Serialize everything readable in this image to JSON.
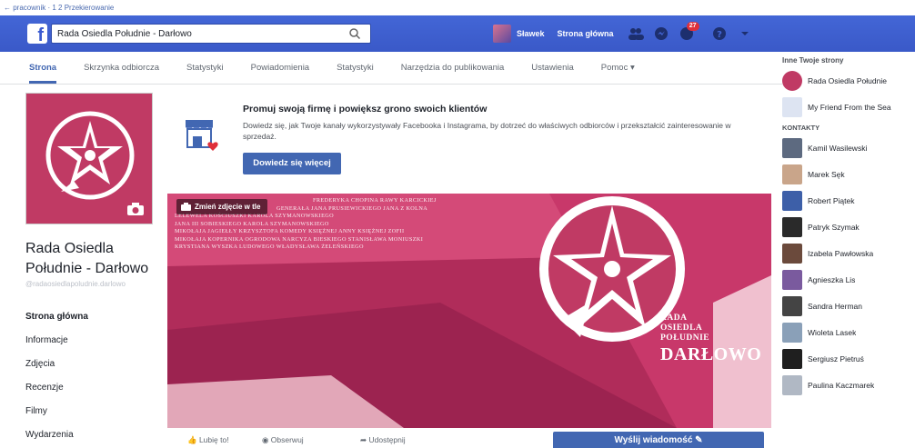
{
  "browser_strip": {
    "text": "← pracownik · 1 2 Przekierowanie"
  },
  "topbar": {
    "search_value": "Rada Osiedla Południe - Darłowo",
    "profile_name": "Sławek",
    "home_label": "Strona główna",
    "notifications_badge": "27",
    "colors": {
      "bar": "#3b5bd0",
      "badge": "#e0303a"
    },
    "icons": [
      "facebook-logo-icon",
      "search-icon",
      "friends-icon",
      "messages-icon",
      "notifications-icon",
      "help-icon",
      "dropdown-icon"
    ]
  },
  "page_tabs": [
    {
      "label": "Strona",
      "active": true
    },
    {
      "label": "Skrzynka odbiorcza",
      "active": false
    },
    {
      "label": "Statystyki",
      "active": false
    },
    {
      "label": "Powiadomienia",
      "active": false
    },
    {
      "label": "Statystyki",
      "active": false
    },
    {
      "label": "Narzędzia do publikowania",
      "active": false
    },
    {
      "label": "Ustawienia",
      "active": false
    },
    {
      "label": "Pomoc ▾",
      "active": false
    }
  ],
  "page": {
    "name": "Rada Osiedla Południe - Darłowo",
    "handle": "@radaosiedlapoludnie.darlowo"
  },
  "left_nav": [
    {
      "label": "Strona główna",
      "active": true
    },
    {
      "label": "Informacje",
      "active": false
    },
    {
      "label": "Zdjęcia",
      "active": false
    },
    {
      "label": "Recenzje",
      "active": false
    },
    {
      "label": "Filmy",
      "active": false
    },
    {
      "label": "Wydarzenia",
      "active": false
    }
  ],
  "promo": {
    "title": "Promuj swoją firmę i powiększ grono swoich klientów",
    "text": "Dowiedz się, jak Twoje kanały wykorzystywały Facebooka i Instagrama, by dotrzeć do właściwych odbiorców i przekształcić zainteresowanie w sprzedaż.",
    "button_label": "Dowiedz się więcej"
  },
  "cover": {
    "change_photo_label": "Zmień zdjęcie w tle",
    "street_lines": [
      "FREDERYKA   CHOPINA   RAWY   KARCICKIEJ",
      "GENERAŁA  JANA  PRUSIEWICKIEGO  JANA  Z  KOLNA",
      "LELEWELA   KOŚCIUSZKI   KAROLA   SZYMANOWSKIEGO",
      "JANA   III   SOBIESKIEGO   KAROLA   SZYMANOWSKIEGO",
      "MIKOŁAJA  JAGIEŁŁY  KRZYSZTOFA  KOMEDY  KSIĘŻNEJ  ANNY  KSIĘŻNEJ  ZOFII",
      "MIKOŁAJA  KOPERNIKA  OGRODOWA  NARCYZA  BIESKIEGO  STANISŁAWA  MONIUSZKI",
      "KRYSTIANA   WYSZKA   LUDOWEGO   WŁADYSŁAWA   ŻELEŃSKIEGO"
    ],
    "title_line1": "RADA",
    "title_line2": "OSIEDLA",
    "title_line3": "POŁUDNIE",
    "title_line4": "DARŁOWO",
    "colors": {
      "background": "#d44a78",
      "dark": "#9c2350"
    }
  },
  "actions": {
    "like": "Lubię to!",
    "follow": "Obserwuj",
    "share": "Udostępnij",
    "send_message": "Wyślij wiadomość"
  },
  "right_column": {
    "heading": "Inne Twoje strony",
    "pages": [
      {
        "name": "Rada Osiedla Południe"
      },
      {
        "name": "My Friend From the Sea"
      }
    ],
    "contacts_heading": "KONTAKTY",
    "contacts": [
      {
        "name": "Kamil Wasilewski"
      },
      {
        "name": "Marek Sęk"
      },
      {
        "name": "Robert Piątek"
      },
      {
        "name": "Patryk Szymak"
      },
      {
        "name": "Izabela Pawłowska"
      },
      {
        "name": "Agnieszka Lis"
      },
      {
        "name": "Sandra Herman"
      },
      {
        "name": "Wioleta Lasek"
      },
      {
        "name": "Sergiusz Pietruś"
      },
      {
        "name": "Paulina Kaczmarek"
      }
    ]
  }
}
